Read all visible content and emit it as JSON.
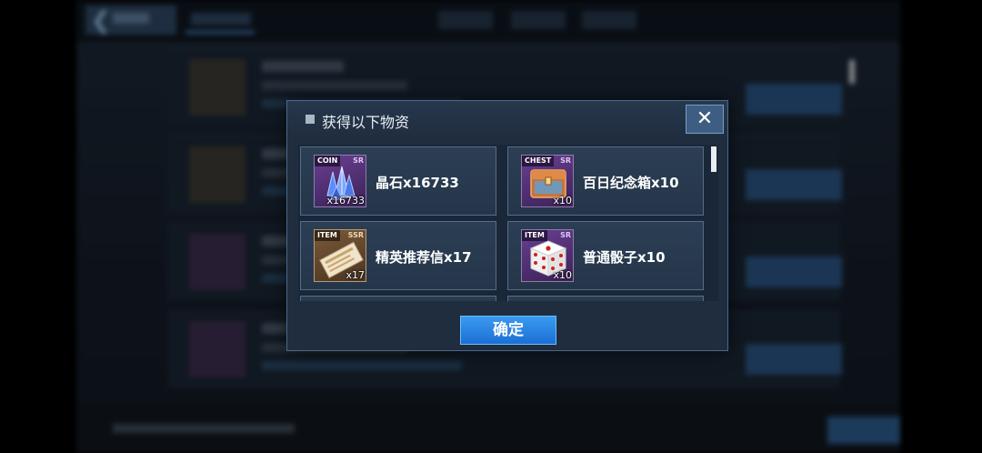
{
  "modal": {
    "title": "获得以下物资",
    "close_label": "✕",
    "confirm_label": "确定",
    "items": [
      {
        "type_tag": "COIN",
        "rarity": "SR",
        "qty_badge": "x16733",
        "name": "晶石x16733",
        "icon": "crystal-icon"
      },
      {
        "type_tag": "CHEST",
        "rarity": "SR",
        "qty_badge": "x10",
        "name": "百日纪念箱x10",
        "icon": "chest-icon"
      },
      {
        "type_tag": "ITEM",
        "rarity": "SSR",
        "qty_badge": "x17",
        "name": "精英推荐信x17",
        "icon": "letter-icon"
      },
      {
        "type_tag": "ITEM",
        "rarity": "SR",
        "qty_badge": "x10",
        "name": "普通骰子x10",
        "icon": "dice-icon"
      }
    ]
  },
  "colors": {
    "accent_blue": "#1c6fd4",
    "sr_purple": "#6a3f92",
    "ssr_gold": "#7a5a38"
  }
}
